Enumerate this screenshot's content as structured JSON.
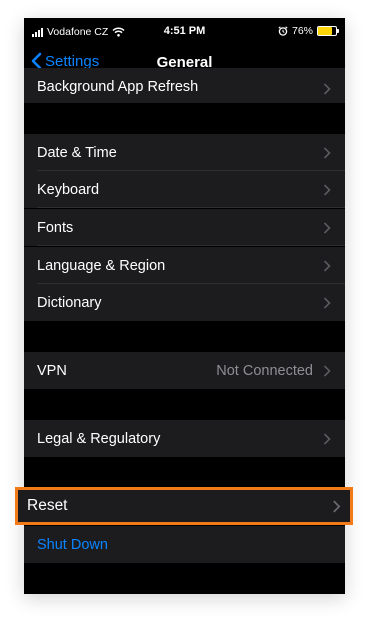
{
  "status_bar": {
    "carrier": "Vodafone CZ",
    "time": "4:51 PM",
    "battery_percent": "76%",
    "battery_level": 0.76,
    "battery_color": "#ffd60a"
  },
  "nav": {
    "back_label": "Settings",
    "title": "General"
  },
  "rows": {
    "background_app_refresh": "Background App Refresh",
    "date_time": "Date & Time",
    "keyboard": "Keyboard",
    "fonts": "Fonts",
    "language_region": "Language & Region",
    "dictionary": "Dictionary",
    "vpn": "VPN",
    "vpn_status": "Not Connected",
    "legal_regulatory": "Legal & Regulatory",
    "reset": "Reset",
    "shut_down": "Shut Down"
  },
  "colors": {
    "accent": "#0a84ff",
    "highlight_border": "#f27a18",
    "cell_background": "#1c1c1e"
  },
  "icons": [
    "signal-bars-icon",
    "wifi-icon",
    "back-chevron-icon",
    "alarm-icon",
    "battery-icon",
    "chevron-right-icon"
  ]
}
